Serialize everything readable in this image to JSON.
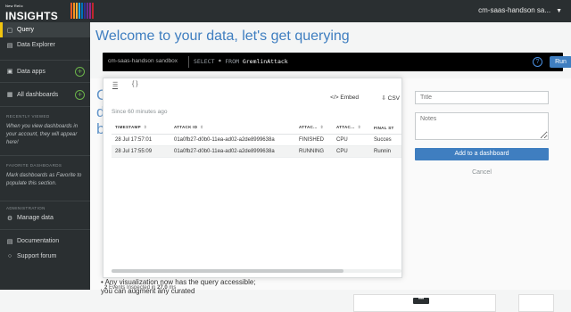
{
  "brand": {
    "small": "New Relic",
    "big": "INSIGHTS"
  },
  "stripe_colors": [
    "#f15a24",
    "#f7931e",
    "#fbb03b",
    "#29abe2",
    "#0071bc",
    "#2e3192",
    "#662d91",
    "#93278f",
    "#c1272d"
  ],
  "account": {
    "name": "cm-saas-handson sa..."
  },
  "sidebar": {
    "nav": [
      {
        "label": "Query",
        "icon": "query-icon",
        "active": true
      },
      {
        "label": "Data Explorer",
        "icon": "data-explorer-icon"
      }
    ],
    "data_apps": "Data apps",
    "all_dashboards": "All dashboards",
    "recently_viewed_title": "RECENTLY VIEWED",
    "recently_viewed_text": "When you view dashboards in your account, they will appear here!",
    "favorite_title": "FAVORITE DASHBOARDS",
    "favorite_text": "Mark dashboards as Favorite to populate this section.",
    "admin_title": "ADMINISTRATION",
    "manage_data": "Manage data",
    "documentation": "Documentation",
    "support_forum": "Support forum"
  },
  "main": {
    "welcome": "Welcome to your data, let's get querying",
    "query_bar": {
      "account": "cm-saas-handson sandbox",
      "keyword_select": "SELECT",
      "star": "*",
      "keyword_from": "FROM",
      "table": "GremlinAttack",
      "help": "?",
      "run": "Run"
    },
    "ghost_letters": [
      "C",
      "d",
      "b"
    ],
    "bullet_text": "Any visualization now has the query accessible; you can augment any curated"
  },
  "results": {
    "tab_table_icon": "☰",
    "tab_json_label": "{ }",
    "embed": "Embed",
    "csv": "CSV",
    "since": "Since 60 minutes ago",
    "columns": [
      "TIMESTAMP",
      "ATTACK ID",
      "ATTAC...",
      "ATTAC...",
      "FINAL ST"
    ],
    "rows": [
      [
        "28 Jul 17:57:01",
        "01a0fb27-d0b0-11ea-ad02-a2de8999638a",
        "FINISHED",
        "CPU",
        "Succes"
      ],
      [
        "28 Jul 17:55:09",
        "01a0fb27-d0b0-11ea-ad02-a2de8999638a",
        "RUNNING",
        "CPU",
        "Runnin"
      ]
    ],
    "events_count": "2",
    "events_text": "Events Inspected in",
    "events_time": "27.0",
    "events_unit": "ms"
  },
  "dashboard_form": {
    "title_placeholder": "Title",
    "notes_placeholder": "Notes",
    "add_label": "Add to a dashboard",
    "cancel_label": "Cancel"
  },
  "more_label": "•••"
}
